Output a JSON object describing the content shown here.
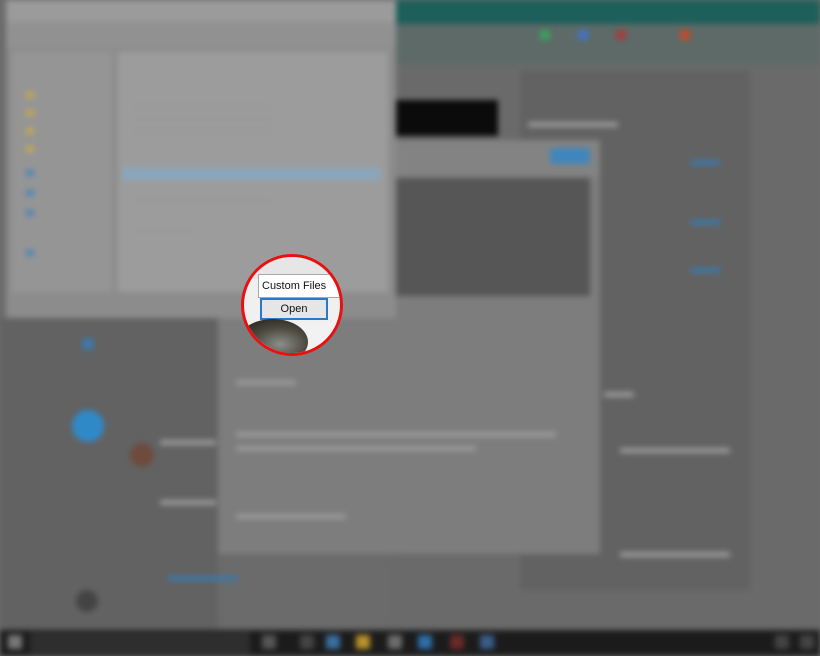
{
  "file_dialog": {
    "filter_value": "Custom Files",
    "open_button_label": "Open"
  },
  "colors": {
    "lens_ring": "#e81010",
    "button_focus": "#2b78c9",
    "accent_blue": "#2f89c9"
  }
}
